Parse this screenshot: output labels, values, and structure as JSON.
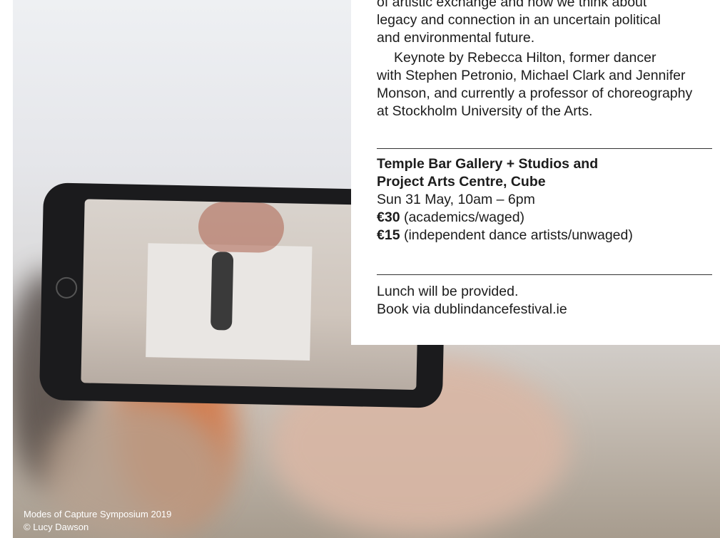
{
  "intro_lines": [
    "of artistic exchange and how we think about",
    "legacy and connection in an uncertain political",
    "and environmental future."
  ],
  "keynote_lines": [
    "Keynote by Rebecca Hilton, former dancer",
    "with Stephen Petronio, Michael Clark and Jennifer",
    "Monson, and currently a professor of choreography",
    "at Stockholm University of the Arts."
  ],
  "venue": {
    "line1": "Temple Bar Gallery + Studios and",
    "line2": "Project Arts Centre, Cube",
    "date_time": "Sun 31 May, 10am – 6pm",
    "price1_amount": "€30",
    "price1_note": " (academics/waged)",
    "price2_amount": "€15",
    "price2_note": " (independent dance artists/unwaged)"
  },
  "info": {
    "lunch": "Lunch will be provided.",
    "booking": "Book via dublindancefestival.ie"
  },
  "caption": {
    "line1": "Modes of Capture Symposium 2019",
    "line2": "© Lucy Dawson"
  }
}
